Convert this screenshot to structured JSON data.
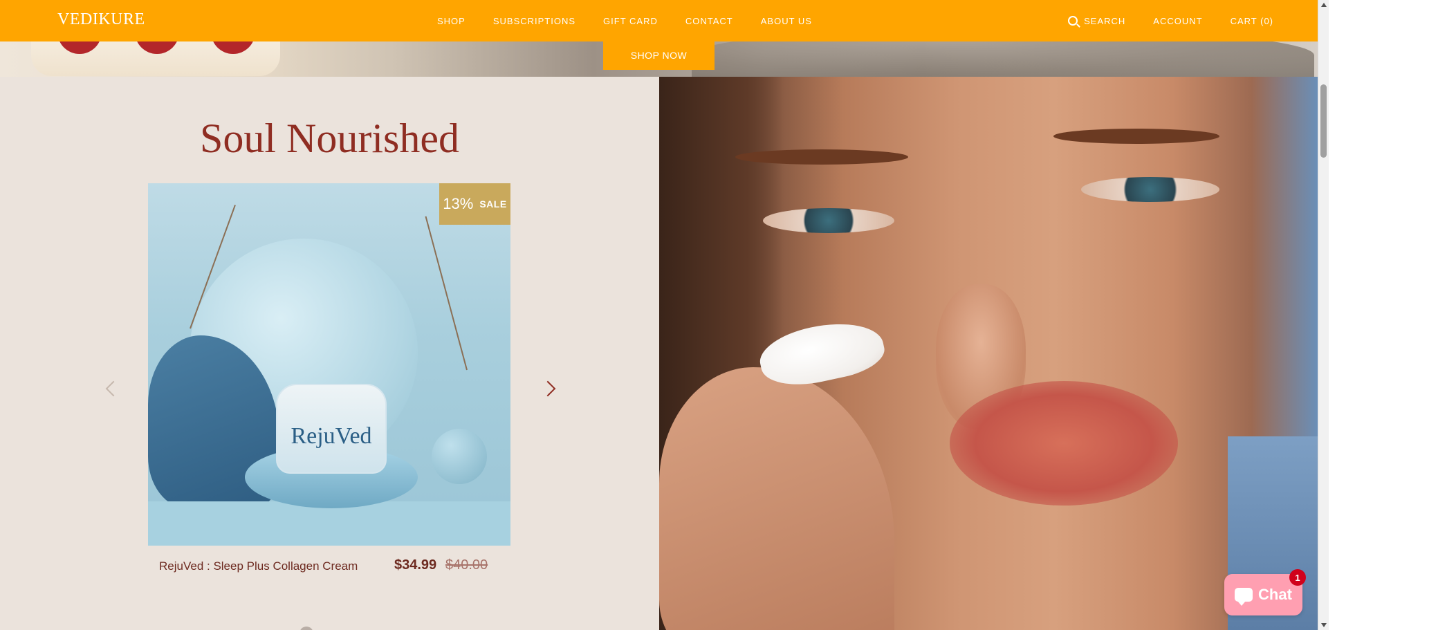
{
  "header": {
    "logo": "VEDIKURE",
    "nav": [
      "SHOP",
      "SUBSCRIPTIONS",
      "GIFT CARD",
      "CONTACT",
      "ABOUT US"
    ],
    "search_label": "SEARCH",
    "account_label": "ACCOUNT",
    "cart_label": "CART (0)",
    "background_color": "#ffa500"
  },
  "hero": {
    "cta_label": "SHOP NOW"
  },
  "featured": {
    "title": "Soul Nourished",
    "product": {
      "name": "RejuVed : Sleep Plus Collagen Cream",
      "price": "$34.99",
      "compare_price": "$40.00",
      "sale_percent": "13%",
      "sale_label": "SALE",
      "jar_label": "RejuVed"
    }
  },
  "chat": {
    "label": "Chat",
    "badge_count": "1"
  },
  "colors": {
    "accent": "#ffa500",
    "title": "#8f2d22",
    "panel_bg": "#ebe3dc",
    "sale_badge": "#c9a95c",
    "chat": "#ff9fb1"
  },
  "icons": {
    "search": "search-icon",
    "chat": "chat-icon",
    "prev": "chevron-left-icon",
    "next": "chevron-right-icon"
  }
}
